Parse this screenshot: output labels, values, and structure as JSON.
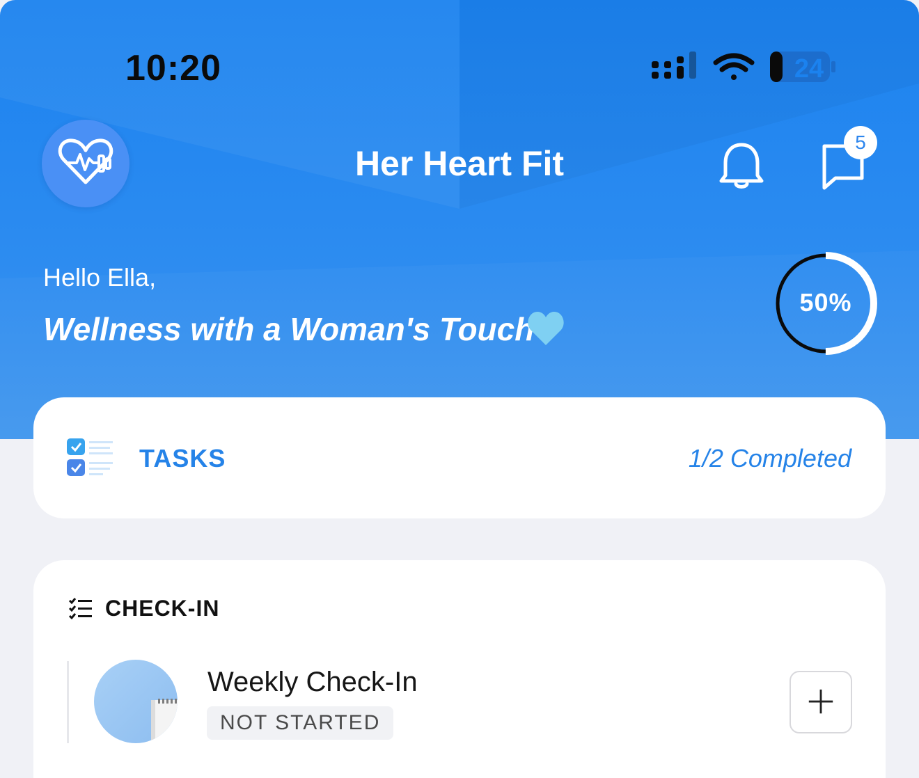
{
  "status_bar": {
    "time": "10:20",
    "battery": "24",
    "icons": [
      "signal-icon",
      "wifi-icon",
      "battery-icon"
    ]
  },
  "header": {
    "title": "Her Heart Fit",
    "logo_icon": "heart-dumbbell-icon",
    "notifications_icon": "bell-icon",
    "messages_icon": "chat-bubble-icon",
    "messages_badge": "5"
  },
  "hero": {
    "greeting": "Hello Ella,",
    "tagline": "Wellness with a Woman's Touch",
    "tagline_emoji": "light-blue-heart-icon",
    "progress_label": "50%",
    "progress_value": 0.5
  },
  "tasks": {
    "label": "TASKS",
    "status": "1/2 Completed",
    "icon": "checklist-icon"
  },
  "checkin": {
    "title": "CHECK-IN",
    "icon": "checklist-small-icon",
    "items": [
      {
        "title": "Weekly Check-In",
        "status": "NOT STARTED",
        "thumbnail_icon": "notepad-thumbnail",
        "action_icon": "plus-icon"
      }
    ]
  },
  "colors": {
    "primary": "#1b82ef",
    "accent_text": "#2583e8",
    "background": "#f0f1f6",
    "card": "#ffffff"
  }
}
